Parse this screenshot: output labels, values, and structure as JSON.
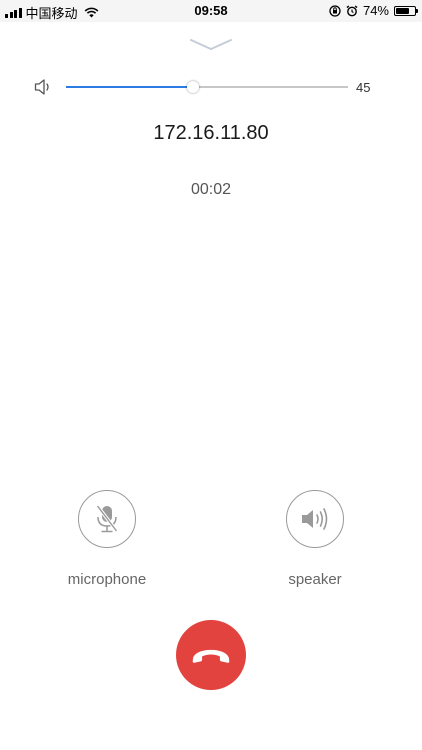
{
  "status_bar": {
    "carrier": "中国移动",
    "time": "09:58",
    "battery_percent": "74%",
    "battery_level": 0.74,
    "icons": [
      "signal-icon",
      "wifi-icon",
      "orientation-lock-icon",
      "alarm-icon",
      "battery-icon"
    ]
  },
  "volume": {
    "value": "45",
    "level": 0.45,
    "accent_color": "#2e7be6"
  },
  "call": {
    "address": "172.16.11.80",
    "duration": "00:02"
  },
  "controls": {
    "microphone": {
      "label": "microphone",
      "icon": "microphone-muted-icon"
    },
    "speaker": {
      "label": "speaker",
      "icon": "speaker-icon"
    }
  },
  "hangup": {
    "icon": "hang-up-phone-icon",
    "color": "#e2433f"
  }
}
